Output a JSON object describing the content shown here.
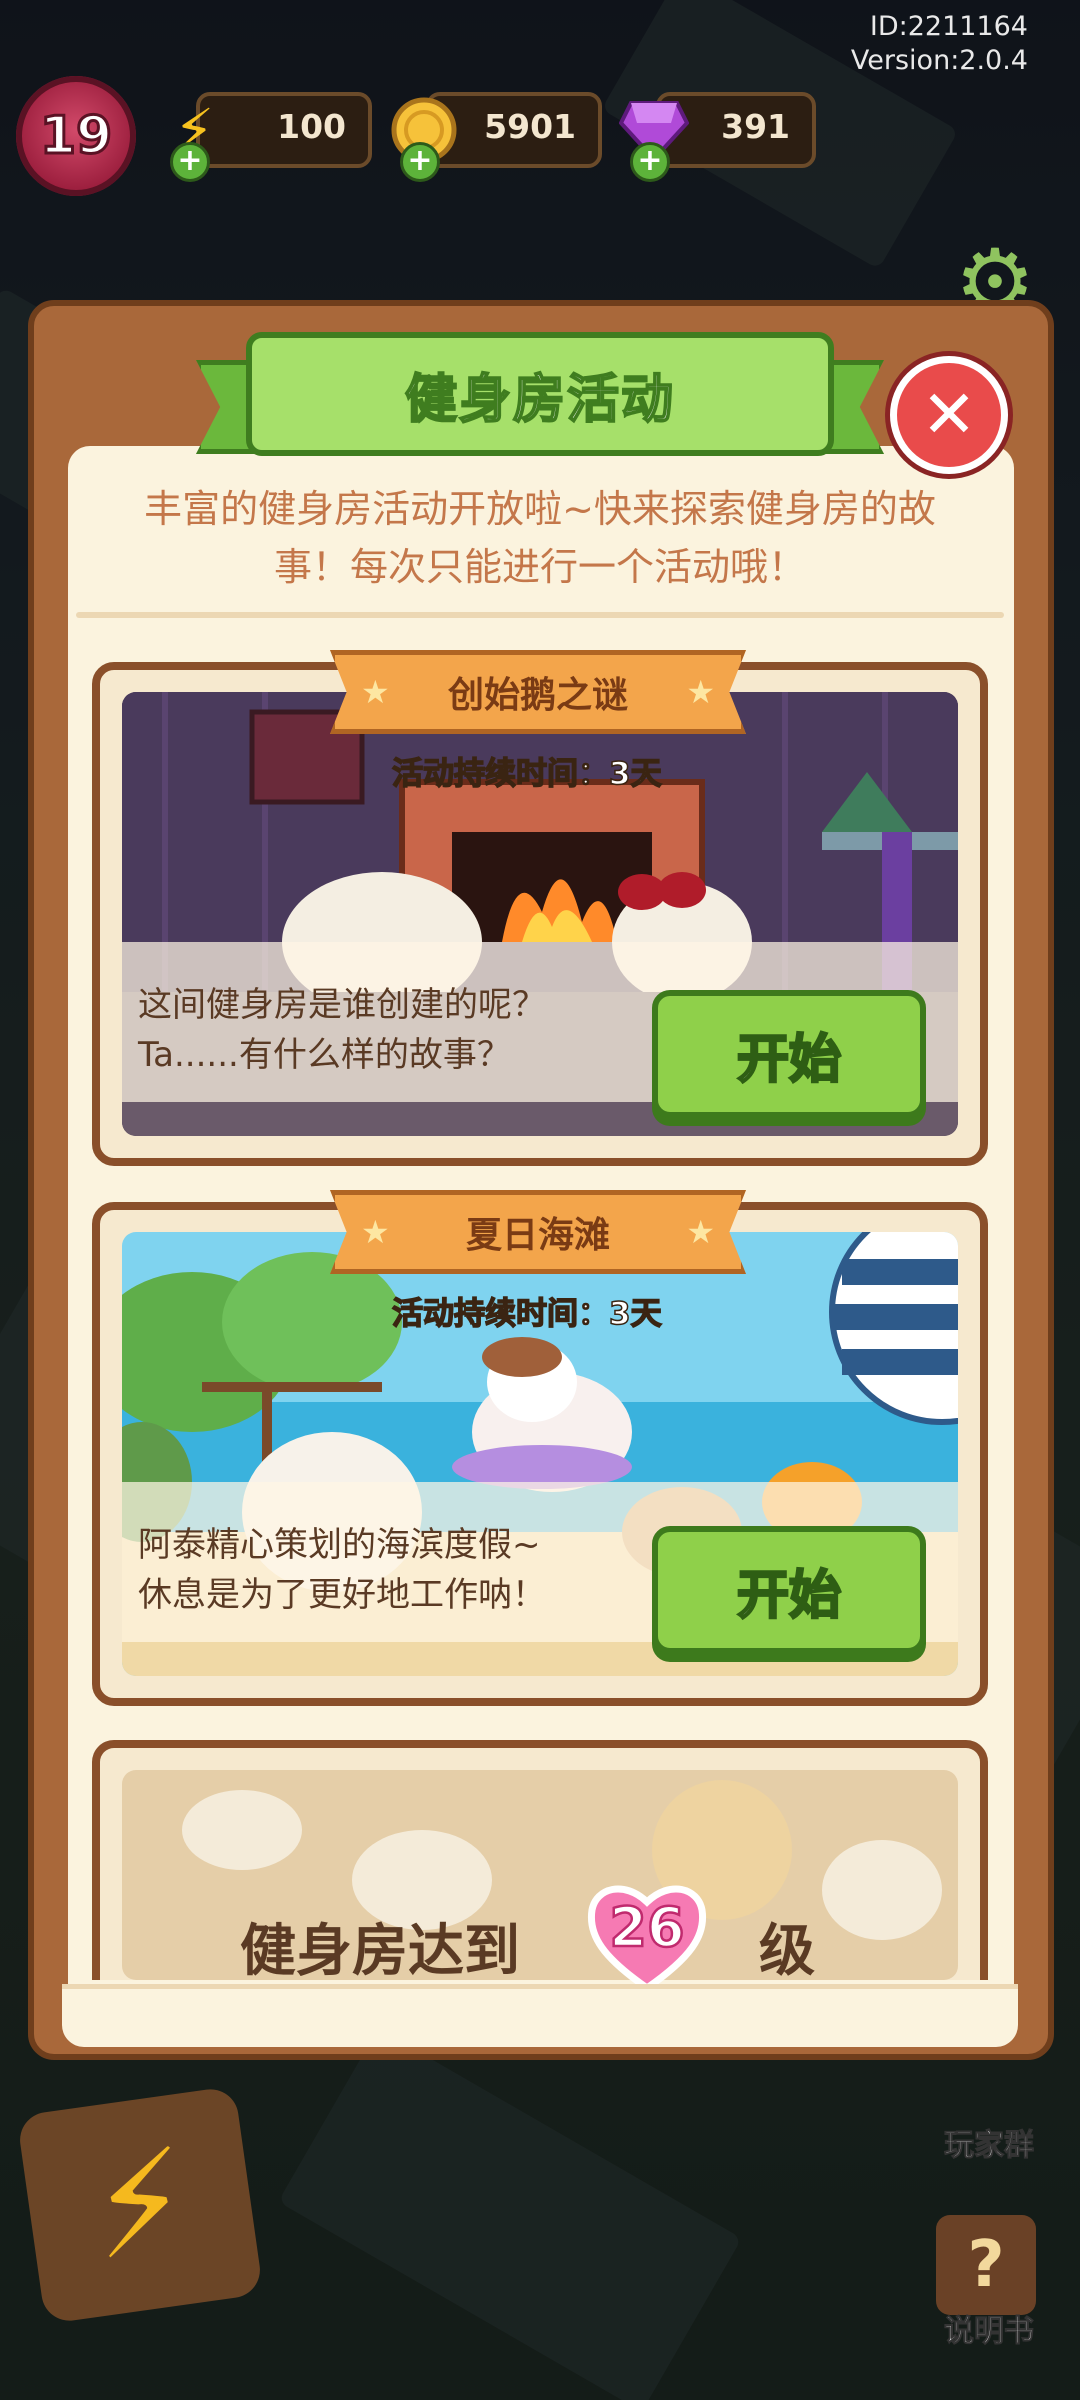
{
  "meta": {
    "id_line": "ID:2211164",
    "version_line": "Version:2.0.4"
  },
  "hud": {
    "level": "19",
    "energy": "100",
    "coins": "5901",
    "gems": "391"
  },
  "dialog": {
    "title": "健身房活动",
    "intro_line1": "丰富的健身房活动开放啦~快来探索健身房的故",
    "intro_line2": "事！每次只能进行一个活动哦！",
    "events": [
      {
        "name": "创始鹅之谜",
        "duration": "活动持续时间：3天",
        "desc_line1": "这间健身房是谁创建的呢？",
        "desc_line2": "Ta......有什么样的故事？",
        "button": "开始"
      },
      {
        "name": "夏日海滩",
        "duration": "活动持续时间：3天",
        "desc_line1": "阿泰精心策划的海滨度假~",
        "desc_line2": "休息是为了更好地工作呐！",
        "button": "开始"
      }
    ],
    "locked": {
      "prefix": "健身房达到",
      "level": "26",
      "suffix": "级"
    }
  },
  "side": {
    "player_group": "玩家群",
    "manual": "说明书"
  },
  "icons": {
    "energy": "lightning-icon",
    "coin": "coin-icon",
    "gem": "gem-icon",
    "close": "close-icon",
    "settings": "gear-icon",
    "star": "star-icon",
    "heart": "heart-icon"
  },
  "colors": {
    "accent_green": "#8fd04a",
    "panel_cream": "#fbf3de",
    "frame_brown": "#a9683a",
    "close_red": "#e94b4b"
  }
}
